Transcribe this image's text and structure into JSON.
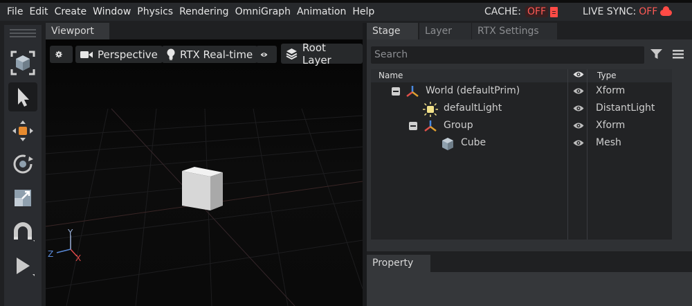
{
  "menu": [
    "File",
    "Edit",
    "Create",
    "Window",
    "Physics",
    "Rendering",
    "OmniGraph",
    "Animation",
    "Help"
  ],
  "status": {
    "cache_label": "CACHE:",
    "cache_value": "OFF",
    "livesync_label": "LIVE SYNC:",
    "livesync_value": "OFF",
    "off_color": "#ff5a55"
  },
  "toolbar": {
    "tools": [
      "camera-cube-icon",
      "select-arrow-icon",
      "move-icon",
      "rotate-icon",
      "scale-icon",
      "snap-magnet-icon",
      "play-icon"
    ],
    "active_tool": "select-arrow-icon"
  },
  "viewport": {
    "tab": "Viewport",
    "settings_icon": "gear-icon",
    "camera_label": "Perspective",
    "renderer_label": "RTX Real-time",
    "visibility_icon": "eye-icon",
    "layer_label": "Root Layer",
    "axis": {
      "y": "Y",
      "z": "Z",
      "x": "X"
    },
    "axis_colors": {
      "x": "#e04a4a",
      "y": "#9ab0d8",
      "z": "#5a8ad8"
    }
  },
  "stage": {
    "tabs": [
      "Stage",
      "Layer",
      "RTX Settings"
    ],
    "active_tab": "Stage",
    "search_placeholder": "Search",
    "columns": {
      "name": "Name",
      "type": "Type"
    },
    "rows": [
      {
        "name": "World (defaultPrim)",
        "type": "Xform",
        "icon": "xform-axes-icon",
        "expanded": true
      },
      {
        "name": "defaultLight",
        "type": "DistantLight",
        "icon": "light-icon"
      },
      {
        "name": "Group",
        "type": "Xform",
        "icon": "xform-axes-icon",
        "expanded": true
      },
      {
        "name": "Cube",
        "type": "Mesh",
        "icon": "mesh-cube-icon"
      }
    ]
  },
  "property": {
    "tab": "Property"
  }
}
